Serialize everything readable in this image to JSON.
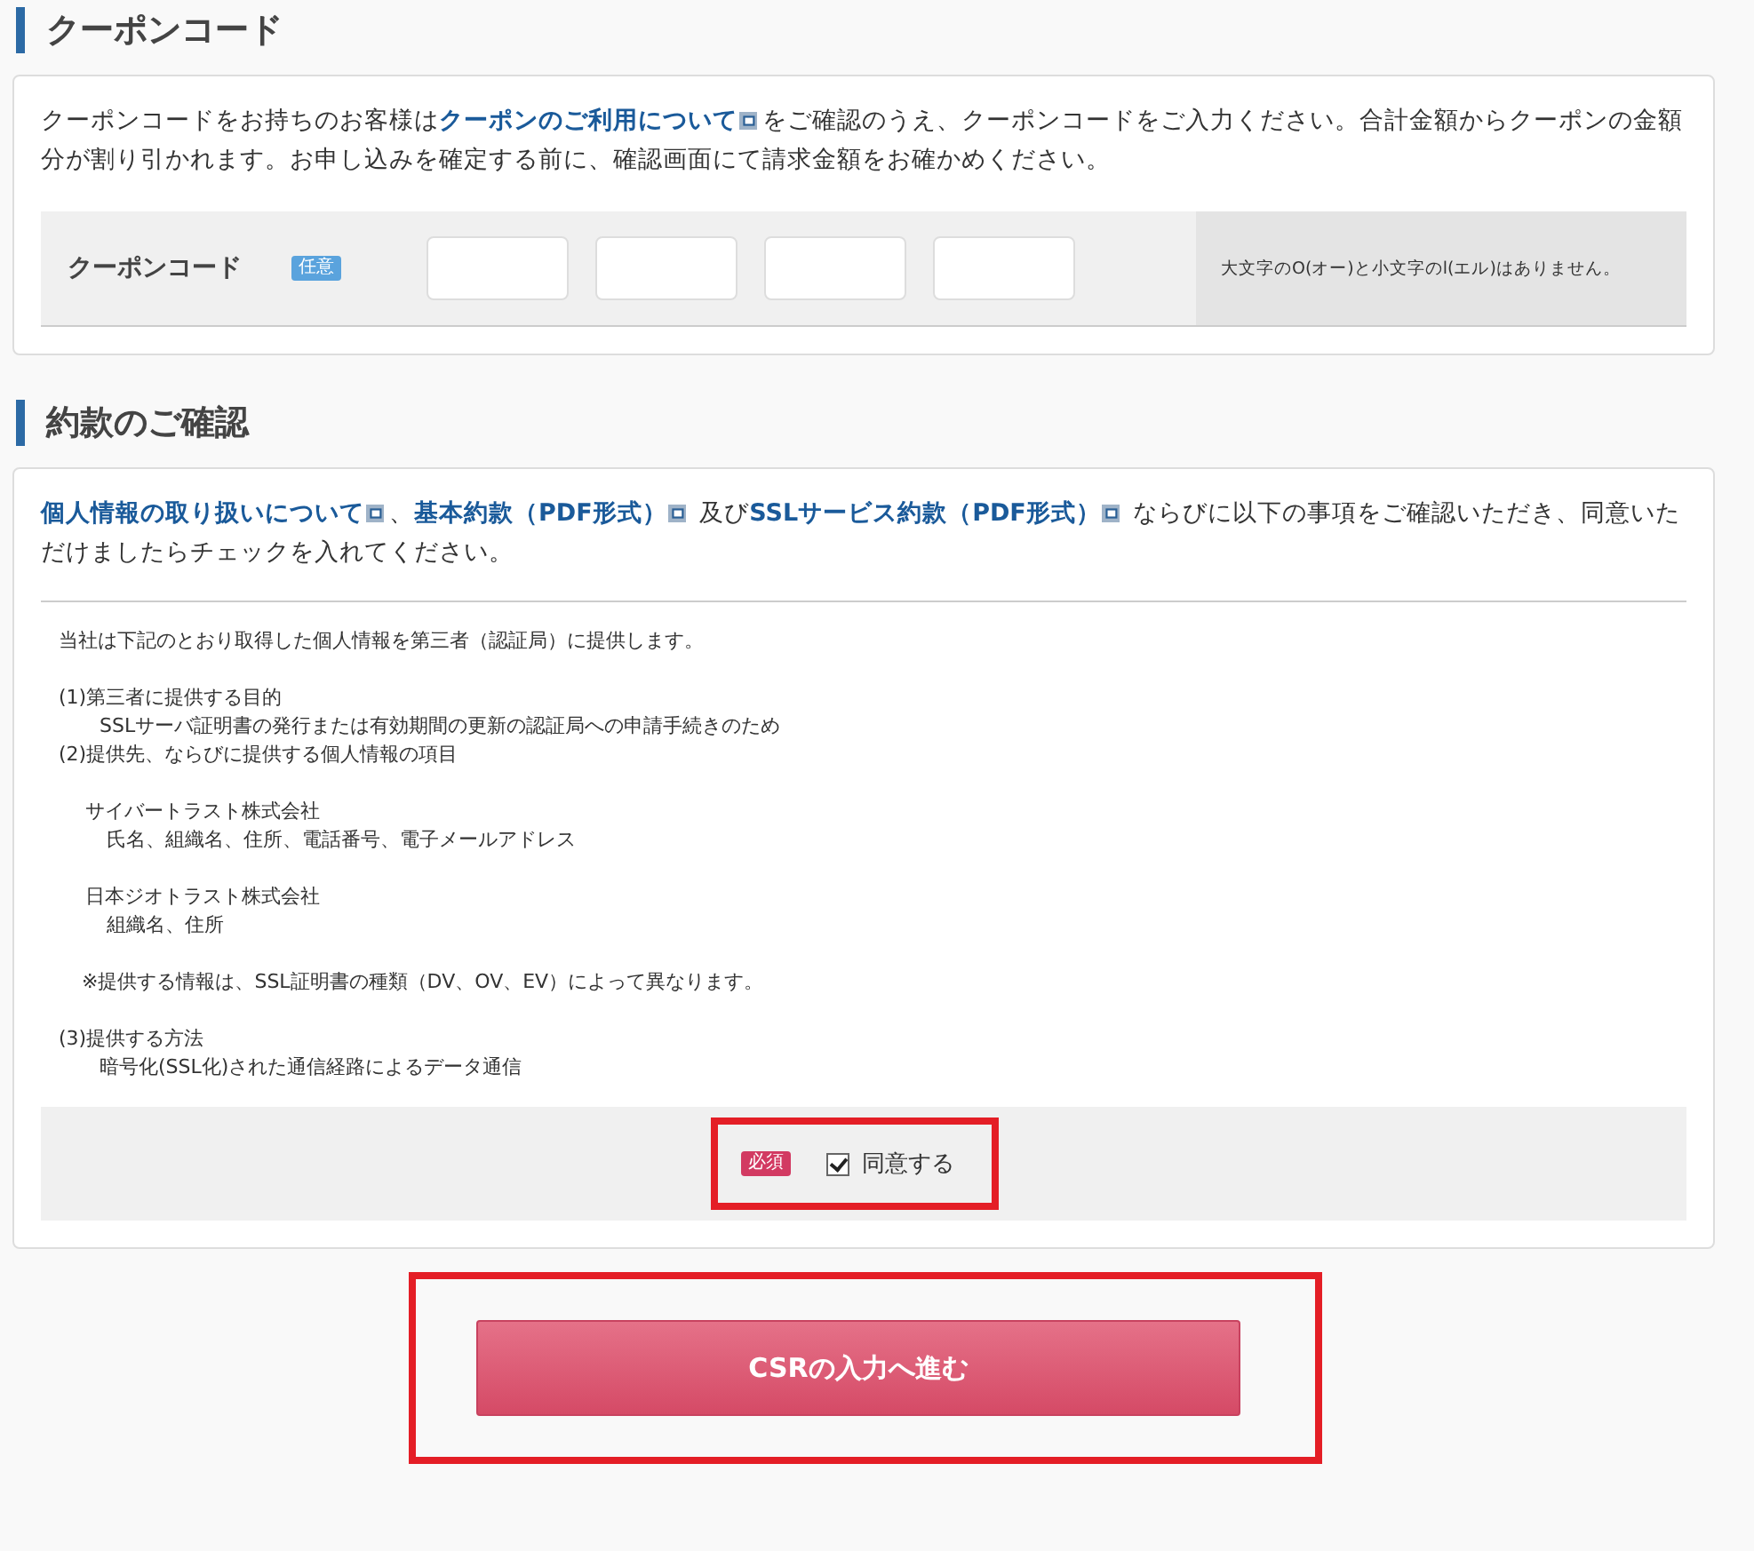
{
  "coupon_section": {
    "heading": "クーポンコード",
    "intro": [
      {
        "kind": "text",
        "text": "クーポンコードをお持ちのお客様は"
      },
      {
        "kind": "link",
        "text": "クーポンのご利用について"
      },
      {
        "kind": "text",
        "text": "をご確認のうえ、クーポンコードをご入力ください。合計金額からクーポンの金額分が割り引かれます。お申し込みを確定する前に、確認画面にて請求金額をお確かめください。"
      }
    ],
    "field_label": "クーポンコード",
    "badge": "任意",
    "inputs": [
      {
        "kind": "text"
      },
      {
        "kind": "text"
      },
      {
        "kind": "text"
      },
      {
        "kind": "text"
      }
    ],
    "note": "大文字のO(オー)と小文字のl(エル)はありません。"
  },
  "terms_section": {
    "heading": "約款のご確認",
    "intro": [
      {
        "kind": "link",
        "text": "個人情報の取り扱いについて"
      },
      {
        "kind": "text",
        "text": "、"
      },
      {
        "kind": "link",
        "text": "基本約款（PDF形式）"
      },
      {
        "kind": "text",
        "text": " 及び"
      },
      {
        "kind": "link",
        "text": "SSLサービス約款（PDF形式）"
      },
      {
        "kind": "text",
        "text": " ならびに以下の事項をご確認いただき、同意いただけましたらチェックを入れてください。"
      }
    ],
    "notice": [
      {
        "kind": "paragraph",
        "text": "当社は下記のとおり取得した個人情報を第三者（認証局）に提供します。"
      },
      {
        "kind": "heading",
        "text": "(1)第三者に提供する目的",
        "children": [
          {
            "text": "SSLサーバ証明書の発行または有効期間の更新の認証局への申請手続きのため"
          }
        ]
      },
      {
        "kind": "heading",
        "text": "(2)提供先、ならびに提供する個人情報の項目",
        "children": [
          {
            "text": "サイバートラスト株式会社",
            "children": [
              {
                "text": "氏名、組織名、住所、電話番号、電子メールアドレス"
              }
            ]
          },
          {
            "text": "日本ジオトラスト株式会社",
            "children": [
              {
                "text": "組織名、住所"
              }
            ]
          }
        ]
      },
      {
        "kind": "note",
        "text": "※提供する情報は、SSL証明書の種類（DV、OV、EV）によって異なります。"
      },
      {
        "kind": "heading",
        "text": "(3)提供する方法",
        "children": [
          {
            "text": "暗号化(SSL化)された通信経路によるデータ通信"
          }
        ]
      }
    ],
    "required_badge": "必須",
    "agree_label": "同意する",
    "agree_checked": true
  },
  "submit_button": "CSRの入力へ進む"
}
